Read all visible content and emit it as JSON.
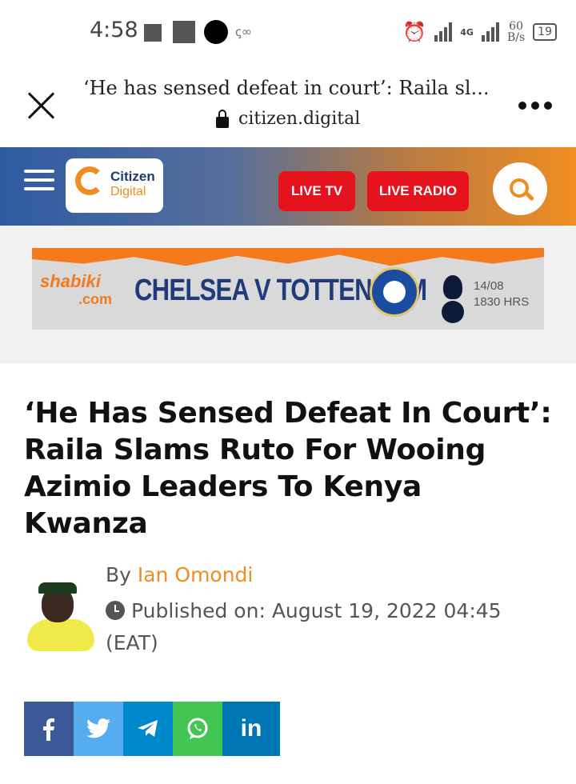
{
  "status_bar": {
    "time": "4:58",
    "net_type": "4G",
    "speed_value": "60",
    "speed_unit": "B/s",
    "battery": "19"
  },
  "browser": {
    "page_title": "‘He has sensed defeat in court’: Raila sl...",
    "url": "citizen.digital"
  },
  "site_header": {
    "logo_line1": "Citizen",
    "logo_line2": "Digital",
    "live_tv_label": "LIVE TV",
    "live_radio_label": "LIVE RADIO",
    "accent_color": "#f08d22",
    "live_color": "#e5131d"
  },
  "ad": {
    "brand_line1": "shabiki",
    "brand_line2": ".com",
    "title": "CHELSEA V TOTTENHAM",
    "date": "14/08",
    "time": "1830 HRS"
  },
  "article": {
    "headline": "‘He Has Sensed Defeat In Court’: Raila Slams Ruto For Wooing Azimio Leaders To Kenya Kwanza",
    "by_label": "By",
    "author": "Ian Omondi",
    "published": "Published on: August 19, 2022 04:45 (EAT)"
  },
  "share": {
    "facebook_icon": "facebook-icon",
    "twitter_icon": "twitter-icon",
    "telegram_icon": "telegram-icon",
    "whatsapp_icon": "whatsapp-icon",
    "linkedin_label": "in",
    "facebook_color": "#3b5998",
    "twitter_color": "#55acee",
    "telegram_color": "#0088cc",
    "whatsapp_color": "#43c553",
    "linkedin_color": "#0077b5"
  }
}
